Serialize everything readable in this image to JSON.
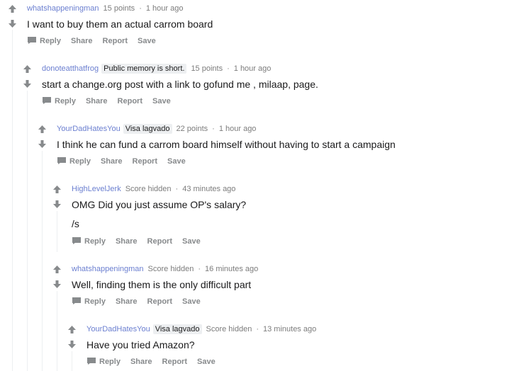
{
  "actions": {
    "reply": "Reply",
    "share": "Share",
    "report": "Report",
    "save": "Save"
  },
  "comments": [
    {
      "author": "whatshappeningman",
      "flair": "",
      "score": "15 points",
      "time": "1 hour ago",
      "body": "I want to buy them an actual carrom board"
    },
    {
      "author": "donoteatthatfrog",
      "flair": "Public memory is short.",
      "score": "15 points",
      "time": "1 hour ago",
      "body": "start a change.org post with a link to gofund me , milaap, page."
    },
    {
      "author": "YourDadHatesYou",
      "flair": "Visa lagvado",
      "score": "22 points",
      "time": "1 hour ago",
      "body": "I think he can fund a carrom board himself without having to start a campaign"
    },
    {
      "author": "HighLevelJerk",
      "flair": "",
      "score": "Score hidden",
      "time": "43 minutes ago",
      "body": "OMG Did you just assume OP's salary?",
      "body2": "/s"
    },
    {
      "author": "whatshappeningman",
      "flair": "",
      "score": "Score hidden",
      "time": "16 minutes ago",
      "body": "Well, finding them is the only difficult part"
    },
    {
      "author": "YourDadHatesYou",
      "flair": "Visa lagvado",
      "score": "Score hidden",
      "time": "13 minutes ago",
      "body": "Have you tried Amazon?"
    }
  ]
}
